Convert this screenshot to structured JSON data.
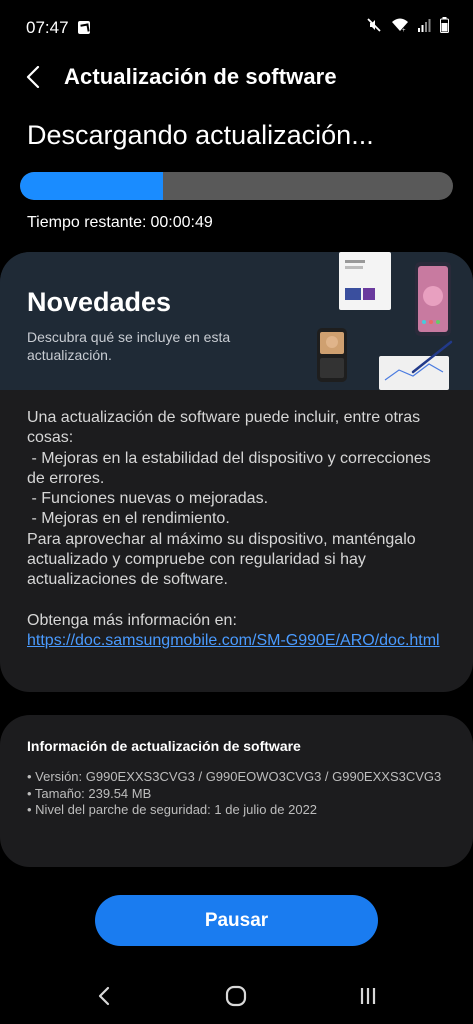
{
  "status_bar": {
    "time": "07:47",
    "icons": [
      "app-notification-icon",
      "mute-icon",
      "wifi-icon",
      "signal-icon",
      "battery-icon"
    ]
  },
  "header": {
    "title": "Actualización de software",
    "back_icon": "chevron-left-icon"
  },
  "download": {
    "status": "Descargando actualización...",
    "progress_fraction": 0.33,
    "remaining_label": "Tiempo restante:",
    "remaining_value": "00:00:49"
  },
  "news": {
    "title": "Novedades",
    "description": "Descubra qué se incluye en esta actualización.",
    "body": "Una actualización de software puede incluir, entre otras cosas:\n - Mejoras en la estabilidad del dispositivo y correcciones de errores.\n - Funciones nuevas o mejoradas.\n - Mejoras en el rendimiento.\nPara aprovechar al máximo su dispositivo, manténgalo actualizado y compruebe con regularidad si hay actualizaciones de software.",
    "more_info_label": "Obtenga más información en:",
    "link": "https://doc.samsungmobile.com/SM-G990E/ARO/doc.html"
  },
  "info": {
    "title": "Información de actualización de software",
    "items": [
      "• Versión: G990EXXS3CVG3 / G990EOWO3CVG3 / G990EXXS3CVG3",
      "• Tamaño: 239.54 MB",
      "• Nivel del parche de seguridad: 1 de julio de 2022"
    ]
  },
  "actions": {
    "pause_label": "Pausar"
  },
  "nav": {
    "back": "back-icon",
    "home": "home-icon",
    "recents": "recents-icon"
  },
  "colors": {
    "accent": "#1a8cff",
    "button": "#1a7cf0",
    "link": "#4a9bff",
    "card": "#1c1c1e",
    "banner": "#1f2a36"
  }
}
